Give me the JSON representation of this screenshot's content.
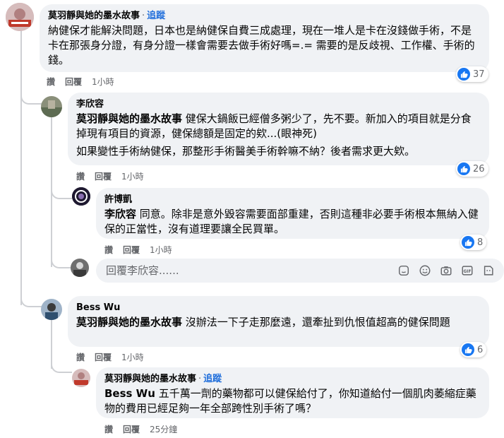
{
  "comments": [
    {
      "author": "莫羽靜與她的墨水故事",
      "follow": "追蹤",
      "mention": "",
      "text": "納健保才能解決問題，日本也是納健保自費三成處理，現在一堆人是卡在沒錢做手術，不是卡在那張身分證，有身分證一樣會需要去做手術好嗎=.= 需要的是反歧視、工作權、手術的錢。",
      "text2": "",
      "like_label": "讚",
      "reply_label": "回覆",
      "time": "1小時",
      "reactions": "37"
    },
    {
      "author": "李欣容",
      "follow": "",
      "mention": "莫羽靜與她的墨水故事",
      "text": "健保大鍋飯已經僧多粥少了，先不要。新加入的項目就是分食掉現有項目的資源，健保總額是固定的欸...(眼神死)",
      "text2": "如果變性手術納健保，那整形手術醫美手術幹嘛不納？後者需求更大欸。",
      "like_label": "讚",
      "reply_label": "回覆",
      "time": "1小時",
      "reactions": "26"
    },
    {
      "author": "許博凱",
      "follow": "",
      "mention": "李欣容",
      "text": "同意。除非是意外毀容需要面部重建，否則這種非必要手術根本無納入健保的正當性，沒有道理要讓全民買單。",
      "text2": "",
      "like_label": "讚",
      "reply_label": "回覆",
      "time": "1小時",
      "reactions": "8"
    },
    {
      "author": "Bess Wu",
      "follow": "",
      "mention": "莫羽靜與她的墨水故事",
      "text": "沒辦法一下子走那麼遠，還牽扯到仇恨值超高的健保問題",
      "text2": "",
      "like_label": "讚",
      "reply_label": "回覆",
      "time": "1小時",
      "reactions": "6"
    },
    {
      "author": "莫羽靜與她的墨水故事",
      "follow": "追蹤",
      "mention": "Bess Wu",
      "text": "五千萬一劑的藥物都可以健保給付了，你知道給付一個肌肉萎縮症藥物的費用已經足夠一年全部跨性別手術了嗎？",
      "text2": "",
      "like_label": "讚",
      "reply_label": "回覆",
      "time": "25分鐘",
      "reactions": ""
    }
  ],
  "reply_box": {
    "placeholder": "回覆李欣容......"
  },
  "icons": {
    "sticker": "sticker-icon",
    "emoji": "emoji-icon",
    "camera": "camera-icon",
    "gif": "gif-icon",
    "avatar-sticker": "avatar-sticker-icon"
  },
  "colors": {
    "accent": "#1877f2",
    "bubble": "#f0f2f5",
    "muted": "#65676b"
  }
}
